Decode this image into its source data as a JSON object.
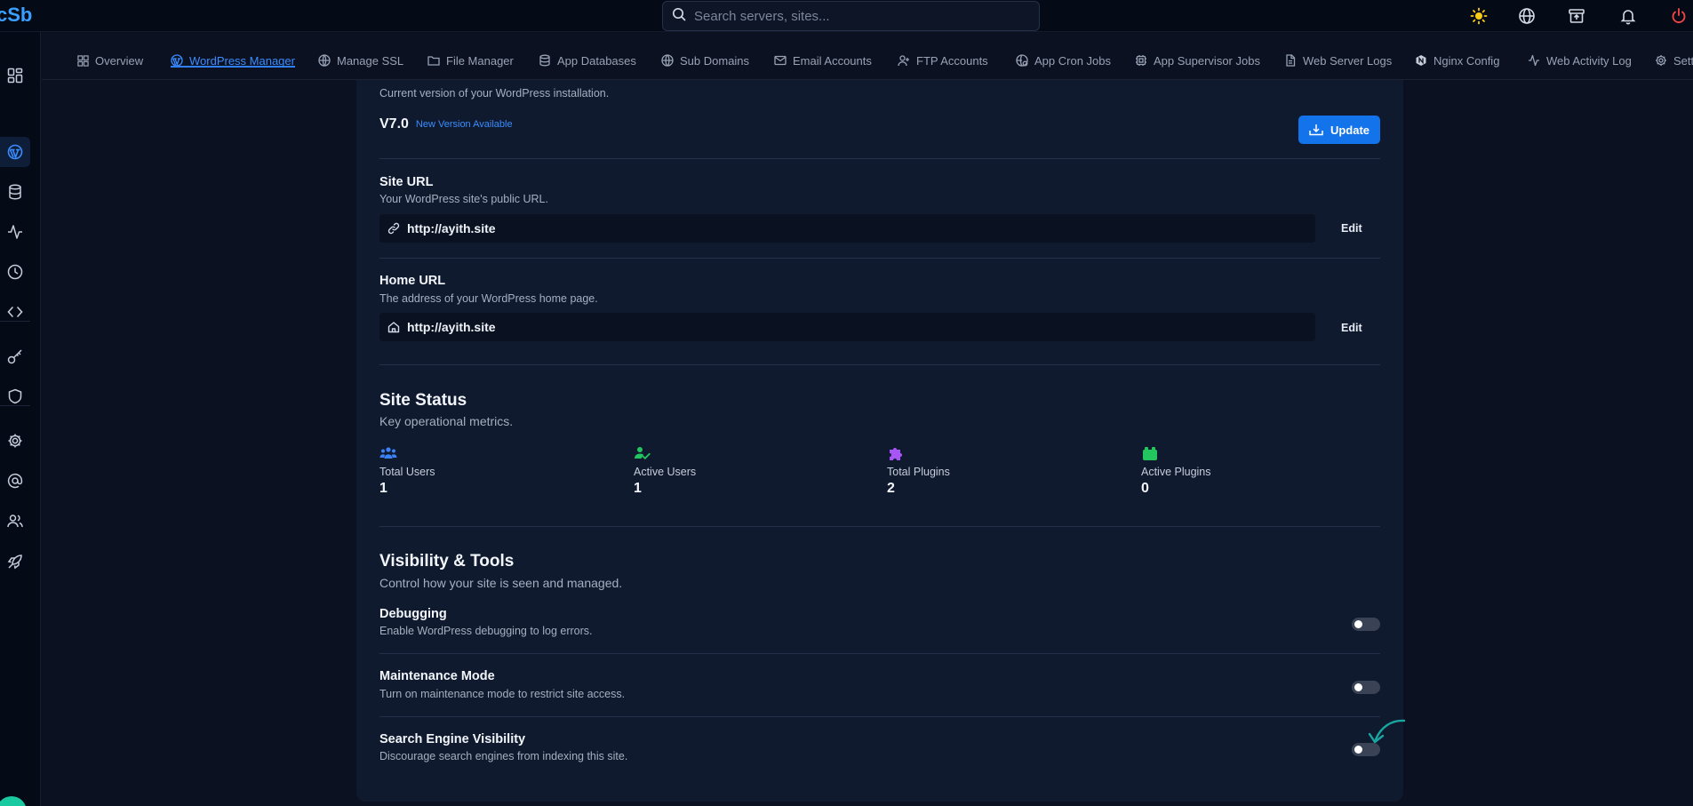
{
  "app": {
    "logo_text": "cSb"
  },
  "search": {
    "placeholder": "Search servers, sites..."
  },
  "top_icons": [
    "sun-icon",
    "globe-icon",
    "archive-icon",
    "bell-icon",
    "power-icon"
  ],
  "tabs": [
    {
      "label": "Overview",
      "icon": "grid-icon",
      "active": false
    },
    {
      "label": "WordPress Manager",
      "icon": "wordpress-icon",
      "active": true
    },
    {
      "label": "Manage SSL",
      "icon": "shield-globe-icon",
      "active": false
    },
    {
      "label": "File Manager",
      "icon": "folder-icon",
      "active": false
    },
    {
      "label": "App Databases",
      "icon": "database-icon",
      "active": false
    },
    {
      "label": "Sub Domains",
      "icon": "globe-icon",
      "active": false
    },
    {
      "label": "Email Accounts",
      "icon": "mail-icon",
      "active": false
    },
    {
      "label": "FTP Accounts",
      "icon": "user-plus-icon",
      "active": false
    },
    {
      "label": "App Cron Jobs",
      "icon": "clock-globe-icon",
      "active": false
    },
    {
      "label": "App Supervisor Jobs",
      "icon": "chip-icon",
      "active": false
    },
    {
      "label": "Web Server Logs",
      "icon": "file-icon",
      "active": false
    },
    {
      "label": "Nginx Config",
      "icon": "nginx-icon",
      "active": false
    },
    {
      "label": "Web Activity Log",
      "icon": "activity-icon",
      "active": false
    },
    {
      "label": "Setti",
      "icon": "gear-icon",
      "active": false
    }
  ],
  "sidebar_icons": [
    "dashboard-icon",
    "wordpress-icon",
    "database-icon",
    "activity-icon",
    "clock-icon",
    "code-icon",
    "key-icon",
    "shield-icon",
    "gear-icon",
    "at-icon",
    "users-icon",
    "rocket-icon"
  ],
  "wp": {
    "version_desc": "Current version of your WordPress installation.",
    "version": "V7.0",
    "new_version": "New Version Available",
    "update_label": "Update",
    "site_url": {
      "title": "Site URL",
      "desc": "Your WordPress site's public URL.",
      "value": "http://ayith.site",
      "edit_label": "Edit"
    },
    "home_url": {
      "title": "Home URL",
      "desc": "The address of your WordPress home page.",
      "value": "http://ayith.site",
      "edit_label": "Edit"
    }
  },
  "status": {
    "title": "Site Status",
    "subtitle": "Key operational metrics.",
    "metrics": [
      {
        "label": "Total Users",
        "value": "1",
        "icon": "users-icon",
        "color": "#3b82f6"
      },
      {
        "label": "Active Users",
        "value": "1",
        "icon": "user-check-icon",
        "color": "#22c55e"
      },
      {
        "label": "Total Plugins",
        "value": "2",
        "icon": "puzzle-icon",
        "color": "#a855f7"
      },
      {
        "label": "Active Plugins",
        "value": "0",
        "icon": "plug-icon",
        "color": "#22c55e"
      }
    ]
  },
  "tools": {
    "title": "Visibility & Tools",
    "subtitle": "Control how your site is seen and managed.",
    "items": [
      {
        "title": "Debugging",
        "desc": "Enable WordPress debugging to log errors.",
        "enabled": false
      },
      {
        "title": "Maintenance Mode",
        "desc": "Turn on maintenance mode to restrict site access.",
        "enabled": false
      },
      {
        "title": "Search Engine Visibility",
        "desc": "Discourage search engines from indexing this site.",
        "enabled": false
      }
    ]
  },
  "colors": {
    "accent": "#1273ea",
    "background": "#0b1120",
    "card": "#0f1a2e",
    "power": "#ef4444",
    "sun": "#facc15"
  }
}
